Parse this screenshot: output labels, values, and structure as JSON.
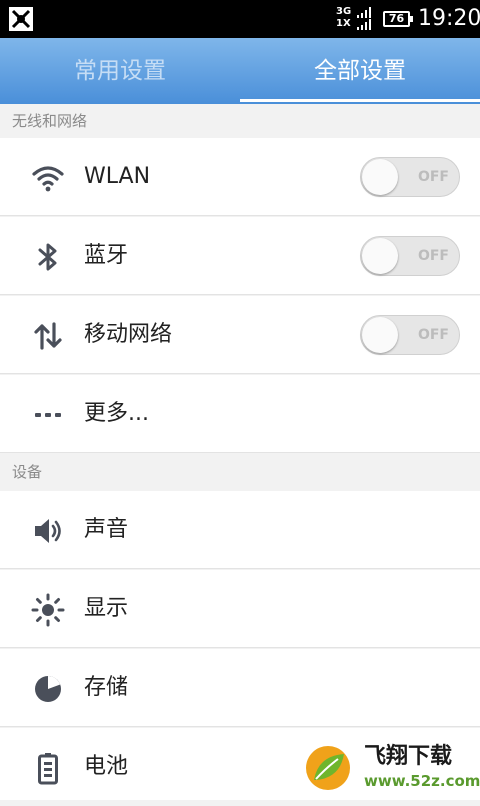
{
  "status_bar": {
    "network_top": "3G",
    "network_bottom": "1X",
    "battery": "76",
    "time": "19:20"
  },
  "tabs": [
    {
      "label": "常用设置",
      "selected": false
    },
    {
      "label": "全部设置",
      "selected": true
    }
  ],
  "sections": [
    {
      "header": "无线和网络",
      "items": [
        {
          "label": "WLAN",
          "icon": "wifi-icon",
          "toggle": "OFF"
        },
        {
          "label": "蓝牙",
          "icon": "bluetooth-icon",
          "toggle": "OFF"
        },
        {
          "label": "移动网络",
          "icon": "mobile-data-icon",
          "toggle": "OFF"
        },
        {
          "label": "更多...",
          "icon": "more-icon"
        }
      ]
    },
    {
      "header": "设备",
      "items": [
        {
          "label": "声音",
          "icon": "speaker-icon"
        },
        {
          "label": "显示",
          "icon": "brightness-icon"
        },
        {
          "label": "存储",
          "icon": "storage-icon"
        },
        {
          "label": "电池",
          "icon": "battery-icon"
        }
      ]
    }
  ],
  "watermark": {
    "title": "飞翔下载",
    "url": "www.52z.com"
  },
  "colors": {
    "tab_bar_top": "#7fb6ea",
    "tab_bar_bottom": "#4a8fd9",
    "icon_gray": "#4a4f5a",
    "status_bar": "#000000"
  }
}
